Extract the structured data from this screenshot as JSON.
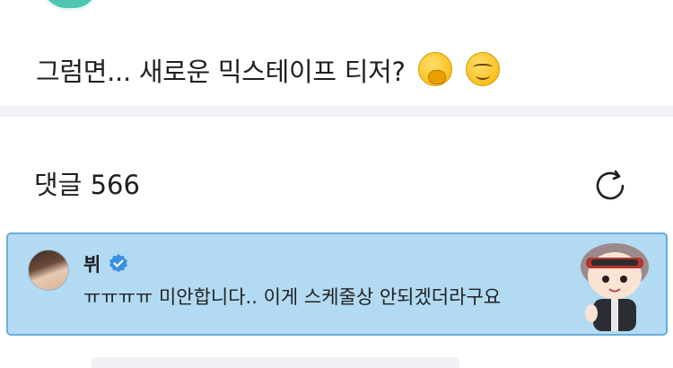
{
  "post": {
    "text": "그럼면... 새로운 믹스테이프 티저?",
    "emojis": [
      "face-with-hand-over-mouth-icon",
      "smiling-face-icon"
    ]
  },
  "comments_section": {
    "label": "댓글",
    "count": "566",
    "refresh_icon": "refresh-icon"
  },
  "highlighted_comment": {
    "author": "뷔",
    "verified": true,
    "text": "ㅠㅠㅠㅠ 미안합니다.. 이게 스케줄상 안되겠더라구요",
    "card_color": "#b3daf3",
    "verified_color": "#3a8ee6"
  }
}
